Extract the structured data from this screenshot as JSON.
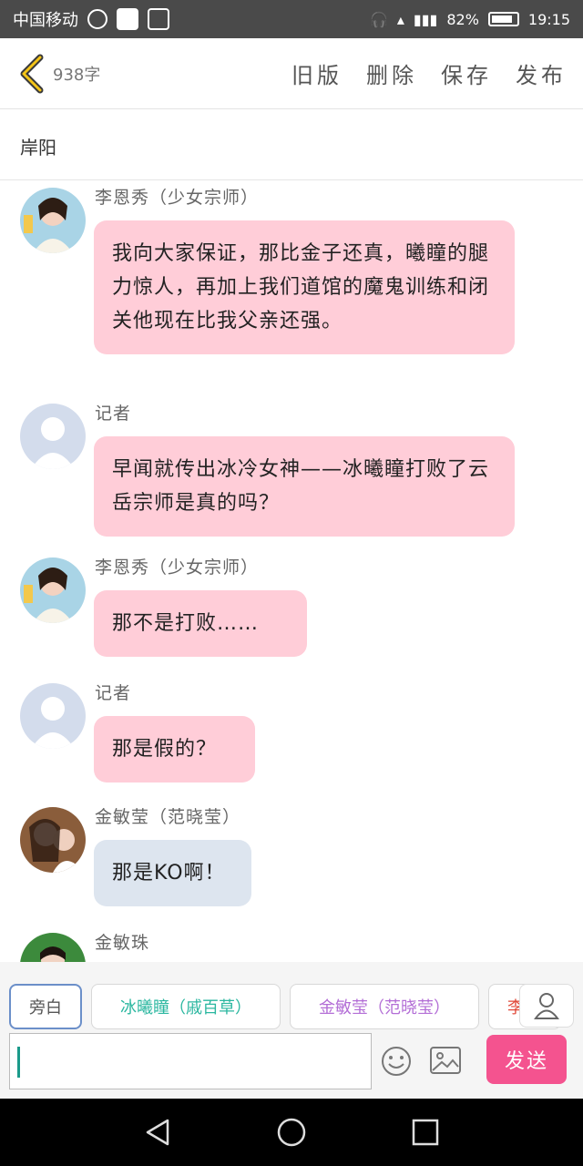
{
  "status_bar": {
    "carrier": "中国移动",
    "battery_percent": "82%",
    "time": "19:15"
  },
  "header": {
    "word_count": "938字",
    "old_version": "旧版",
    "delete": "删除",
    "save": "保存",
    "publish": "发布"
  },
  "chapter": {
    "title": "岸阳"
  },
  "messages": [
    {
      "name": "李恩秀（少女宗师）",
      "text": "我向大家保证，那比金子还真，曦瞳的腿力惊人，再加上我们道馆的魔鬼训练和闭关他现在比我父亲还强。",
      "color": "pink"
    },
    {
      "name": "记者",
      "text": "早闻就传出冰冷女神——冰曦瞳打败了云岳宗师是真的吗？",
      "color": "pink"
    },
    {
      "name": "李恩秀（少女宗师）",
      "text": "那不是打败……",
      "color": "pink"
    },
    {
      "name": "记者",
      "text": "那是假的？",
      "color": "pink"
    },
    {
      "name": "金敏莹（范晓莹）",
      "text": "那是KO啊！",
      "color": "blue"
    },
    {
      "name": "金敏珠",
      "text": "",
      "color": "pink"
    }
  ],
  "roles": [
    {
      "label": "旁白",
      "color": "#555555",
      "active": true
    },
    {
      "label": "冰曦瞳（戚百草）",
      "color": "#2bb7a0",
      "active": false
    },
    {
      "label": "金敏莹（范晓莹）",
      "color": "#b36ed6",
      "active": false
    },
    {
      "label": "李",
      "color": "#e04a3a",
      "active": false
    }
  ],
  "composer": {
    "placeholder": "",
    "send_label": "发送"
  }
}
